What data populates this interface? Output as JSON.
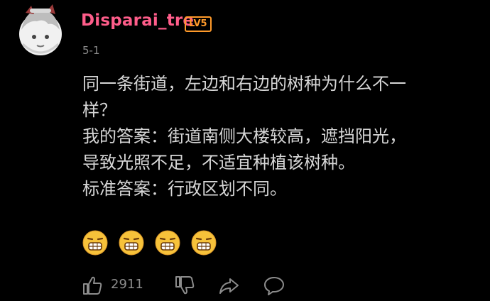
{
  "comment": {
    "author": {
      "name": "Disparai_tre",
      "level_badge": "LV5"
    },
    "date": "5-1",
    "lines": [
      "同一条街道，左边和右边的树种为什么不一",
      "样？",
      "我的答案：街道南侧大楼较高，遮挡阳光，",
      "导致光照不足，不适宜种植该树种。",
      "标准答案：行政区划不同。"
    ],
    "emojis": [
      "grimace-emoji",
      "grimace-emoji",
      "grimace-emoji",
      "grimace-emoji"
    ],
    "actions": {
      "like_count": "2911",
      "icons": [
        "thumbs-up-icon",
        "thumbs-down-icon",
        "share-icon",
        "reply-icon"
      ]
    }
  },
  "colors": {
    "background": "#000000",
    "username": "#ff5d8a",
    "badge": "#ff9a2a",
    "text": "#d6d6d6",
    "muted": "#8c8c8c"
  }
}
